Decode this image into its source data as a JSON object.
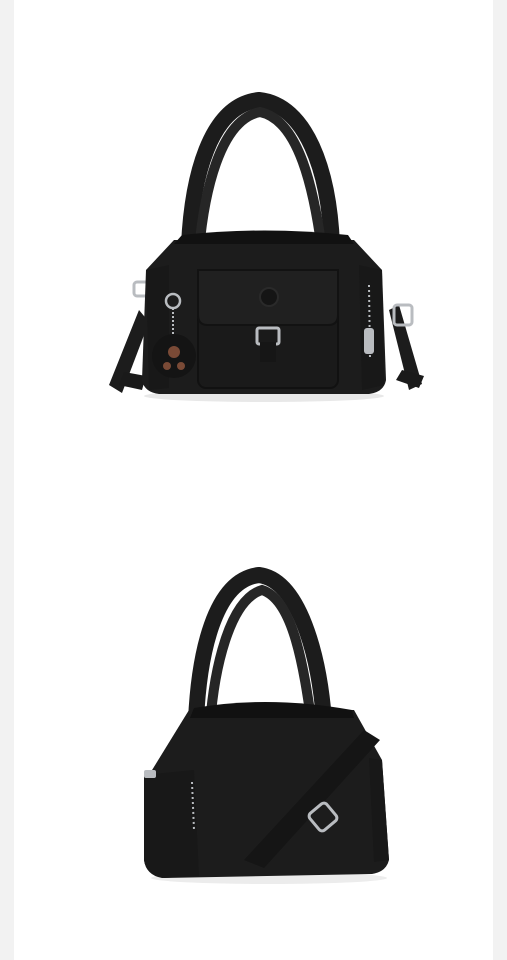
{
  "gallery": {
    "images": [
      {
        "name": "bag-front-view",
        "view": "front"
      },
      {
        "name": "bag-back-view",
        "view": "back"
      }
    ]
  },
  "colors": {
    "page_border": "#f2f2f2",
    "canvas": "#ffffff",
    "bag_body": "#1c1c1c",
    "bag_shadow": "#111111",
    "hardware": "#b9bcc0",
    "charm_face": "#7a4a36"
  }
}
